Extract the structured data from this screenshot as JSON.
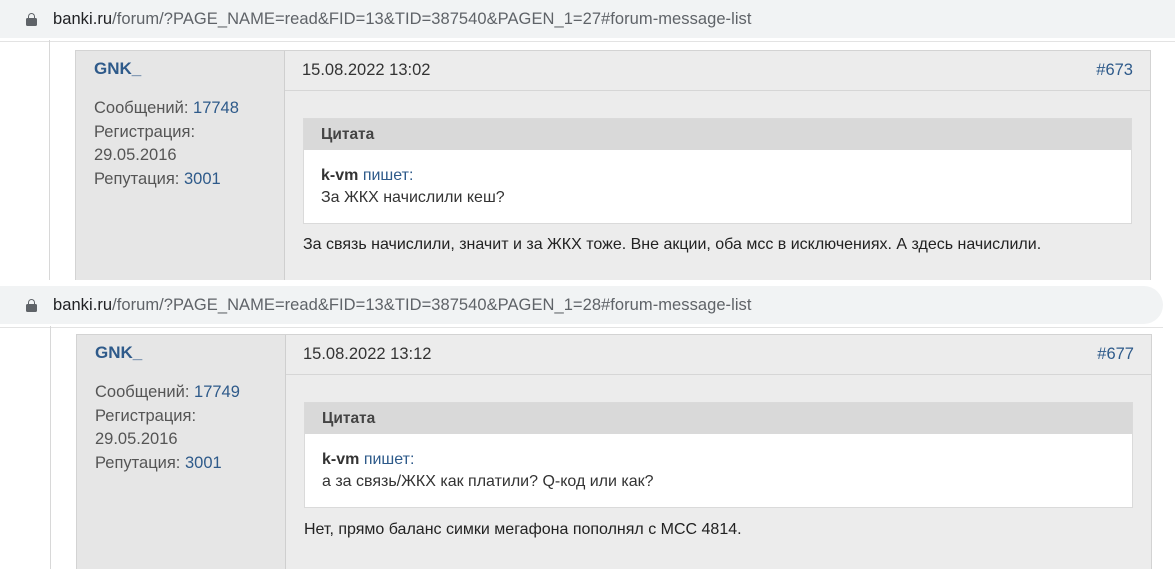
{
  "posts": [
    {
      "url": {
        "host": "banki.ru",
        "path": "/forum/?PAGE_NAME=read&FID=13&TID=387540&PAGEN_1=27#forum-message-list"
      },
      "author": {
        "name": "GNK_",
        "messages_label": "Сообщений:",
        "messages_count": "17748",
        "registration_label": "Регистрация:",
        "registration_date": "29.05.2016",
        "reputation_label": "Репутация:",
        "reputation": "3001"
      },
      "date": "15.08.2022 13:02",
      "number": "#673",
      "quote": {
        "title": "Цитата",
        "author": "k-vm",
        "writes": "пишет:",
        "text": "За ЖКХ начислили кеш?"
      },
      "reply": "За связь начислили, значит и за ЖКХ тоже. Вне акции, оба мсс в исключениях. А здесь начислили."
    },
    {
      "url": {
        "host": "banki.ru",
        "path": "/forum/?PAGE_NAME=read&FID=13&TID=387540&PAGEN_1=28#forum-message-list"
      },
      "author": {
        "name": "GNK_",
        "messages_label": "Сообщений:",
        "messages_count": "17749",
        "registration_label": "Регистрация:",
        "registration_date": "29.05.2016",
        "reputation_label": "Репутация:",
        "reputation": "3001"
      },
      "date": "15.08.2022 13:12",
      "number": "#677",
      "quote": {
        "title": "Цитата",
        "author": "k-vm",
        "writes": "пишет:",
        "text": "а за связь/ЖКХ как платили? Q-код или как?"
      },
      "reply": "Нет, прямо баланс симки мегафона пополнял с МСС 4814."
    }
  ],
  "colors": {
    "link": "#2e5a8a",
    "address_bar": "#f1f3f4",
    "post_background": "#e9e9e9",
    "quote_header": "#d9d9d9"
  },
  "icons": {
    "url_lock": "lock-icon"
  }
}
